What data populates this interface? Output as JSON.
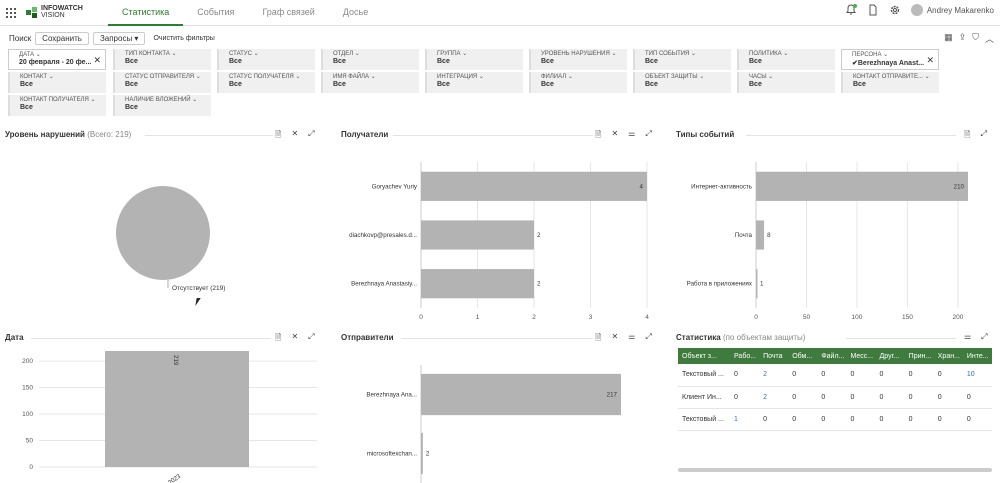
{
  "logo": {
    "line1": "INFOWATCH",
    "line2": "VISION"
  },
  "tabs": [
    "Статистика",
    "События",
    "Граф связей",
    "Досье"
  ],
  "user": {
    "name": "Andrey Makarenko"
  },
  "toolbar": {
    "search": "Поиск",
    "save": "Сохранить",
    "queries": "Запросы ▾",
    "clear": "Очистить фильтры"
  },
  "filters": [
    {
      "name": "ДАТА ⌄",
      "value": "20 февраля - 20 фе...",
      "selected": true,
      "close": "✕"
    },
    {
      "name": "ТИП КОНТАКТА ⌄",
      "value": "Все"
    },
    {
      "name": "СТАТУС ⌄",
      "value": "Все"
    },
    {
      "name": "ОТДЕЛ ⌄",
      "value": "Все"
    },
    {
      "name": "ГРУППА ⌄",
      "value": "Все"
    },
    {
      "name": "УРОВЕНЬ НАРУШЕНИЯ ⌄",
      "value": "Все"
    },
    {
      "name": "ТИП СОБЫТИЯ ⌄",
      "value": "Все"
    },
    {
      "name": "ПОЛИТИКА ⌄",
      "value": "Все"
    },
    {
      "name": "ПЕРСОНА ⌄",
      "value": "✔Berezhnaya Anast...",
      "selected": true,
      "close": "✕"
    },
    {
      "name": "КОНТАКТ ⌄",
      "value": "Все"
    },
    {
      "name": "СТАТУС ОТПРАВИТЕЛЯ ⌄",
      "value": "Все"
    },
    {
      "name": "СТАТУС ПОЛУЧАТЕЛЯ ⌄",
      "value": "Все"
    },
    {
      "name": "ИМЯ ФАЙЛА ⌄",
      "value": "Все"
    },
    {
      "name": "ИНТЕГРАЦИЯ ⌄",
      "value": "Все"
    },
    {
      "name": "ФИЛИАЛ ⌄",
      "value": "Все"
    },
    {
      "name": "ОБЪЕКТ ЗАЩИТЫ ⌄",
      "value": "Все"
    },
    {
      "name": "ЧАСЫ ⌄",
      "value": "Все"
    },
    {
      "name": "КОНТАКТ ОТПРАВИТЕ... ⌄",
      "value": "Все"
    },
    {
      "name": "КОНТАКТ ПОЛУЧАТЕЛЯ ⌄",
      "value": "Все"
    },
    {
      "name": "НАЛИЧИЕ ВЛОЖЕНИЙ ⌄",
      "value": "Все"
    }
  ],
  "panels": {
    "violations": {
      "title": "Уровень нарушений",
      "sub": "(Всего: 219)"
    },
    "recipients": {
      "title": "Получатели"
    },
    "event_types": {
      "title": "Типы событий"
    },
    "date": {
      "title": "Дата"
    },
    "senders": {
      "title": "Отправители"
    },
    "stats": {
      "title": "Статистика",
      "sub": "(по объектам защиты)"
    }
  },
  "chart_data": [
    {
      "type": "pie",
      "title": "Уровень нарушений",
      "slices": [
        {
          "label": "Отсутствует (219)",
          "value": 219
        }
      ],
      "colors": [
        "#b3b3b3"
      ]
    },
    {
      "type": "bar",
      "orientation": "horizontal",
      "title": "Получатели",
      "categories": [
        "Goryachev Yuriy",
        "diachkovp@presales.d...",
        "Berezhnaya Anastasiy..."
      ],
      "values": [
        4,
        2,
        2
      ],
      "xlim": [
        0,
        4
      ],
      "xticks": [
        0,
        1,
        2,
        3,
        4
      ],
      "grid": true
    },
    {
      "type": "bar",
      "orientation": "horizontal",
      "title": "Типы событий",
      "categories": [
        "Интернет-активность",
        "Почта",
        "Работа в приложениях"
      ],
      "values": [
        210,
        8,
        1
      ],
      "xlim": [
        0,
        210
      ],
      "xticks": [
        0,
        50,
        100,
        150,
        200
      ],
      "grid": true
    },
    {
      "type": "bar",
      "orientation": "vertical",
      "title": "Дата",
      "categories": [
        "20.02.2023"
      ],
      "values": [
        219
      ],
      "ylim": [
        0,
        219
      ],
      "yticks": [
        0,
        50,
        100,
        150,
        200
      ],
      "grid": true
    },
    {
      "type": "bar",
      "orientation": "horizontal",
      "title": "Отправители",
      "categories": [
        "Berezhnaya Ana...",
        "microsoftexchan..."
      ],
      "values": [
        217,
        2
      ],
      "xlim": [
        0,
        217
      ],
      "grid": true
    }
  ],
  "stats_table": {
    "headers": [
      "Объект з...",
      "Рабо...",
      "Почта",
      "Обм...",
      "Файл...",
      "Месс...",
      "Друг...",
      "Прин...",
      "Хран...",
      "Инте..."
    ],
    "rows": [
      [
        "Текстовый ...",
        "0",
        "2",
        "0",
        "0",
        "0",
        "0",
        "0",
        "0",
        "10"
      ],
      [
        "Клиент Ин...",
        "0",
        "2",
        "0",
        "0",
        "0",
        "0",
        "0",
        "0",
        "0"
      ],
      [
        "Текстовый ...",
        "1",
        "0",
        "0",
        "0",
        "0",
        "0",
        "0",
        "0",
        "0"
      ]
    ]
  },
  "icons": {
    "bell": "bell-icon",
    "doc": "document-icon",
    "gear": "gear-icon",
    "export": "export-icon",
    "share": "share-icon",
    "filter": "filter-icon",
    "collapse": "collapse-icon",
    "close": "close-icon",
    "expand": "expand-icon",
    "settings": "sliders-icon"
  }
}
